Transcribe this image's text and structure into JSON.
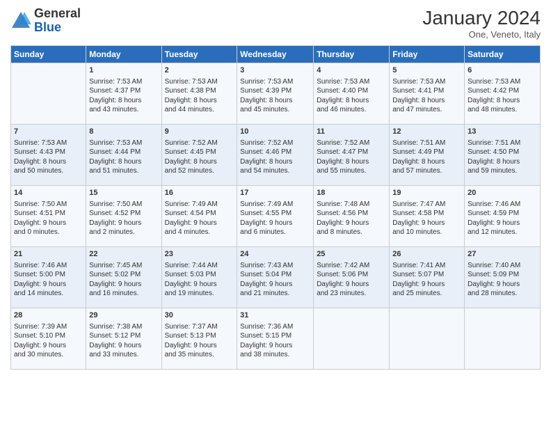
{
  "logo": {
    "general": "General",
    "blue": "Blue"
  },
  "title": "January 2024",
  "subtitle": "One, Veneto, Italy",
  "headers": [
    "Sunday",
    "Monday",
    "Tuesday",
    "Wednesday",
    "Thursday",
    "Friday",
    "Saturday"
  ],
  "weeks": [
    [
      {
        "day": "",
        "info": ""
      },
      {
        "day": "1",
        "info": "Sunrise: 7:53 AM\nSunset: 4:37 PM\nDaylight: 8 hours\nand 43 minutes."
      },
      {
        "day": "2",
        "info": "Sunrise: 7:53 AM\nSunset: 4:38 PM\nDaylight: 8 hours\nand 44 minutes."
      },
      {
        "day": "3",
        "info": "Sunrise: 7:53 AM\nSunset: 4:39 PM\nDaylight: 8 hours\nand 45 minutes."
      },
      {
        "day": "4",
        "info": "Sunrise: 7:53 AM\nSunset: 4:40 PM\nDaylight: 8 hours\nand 46 minutes."
      },
      {
        "day": "5",
        "info": "Sunrise: 7:53 AM\nSunset: 4:41 PM\nDaylight: 8 hours\nand 47 minutes."
      },
      {
        "day": "6",
        "info": "Sunrise: 7:53 AM\nSunset: 4:42 PM\nDaylight: 8 hours\nand 48 minutes."
      }
    ],
    [
      {
        "day": "7",
        "info": "Sunrise: 7:53 AM\nSunset: 4:43 PM\nDaylight: 8 hours\nand 50 minutes."
      },
      {
        "day": "8",
        "info": "Sunrise: 7:53 AM\nSunset: 4:44 PM\nDaylight: 8 hours\nand 51 minutes."
      },
      {
        "day": "9",
        "info": "Sunrise: 7:52 AM\nSunset: 4:45 PM\nDaylight: 8 hours\nand 52 minutes."
      },
      {
        "day": "10",
        "info": "Sunrise: 7:52 AM\nSunset: 4:46 PM\nDaylight: 8 hours\nand 54 minutes."
      },
      {
        "day": "11",
        "info": "Sunrise: 7:52 AM\nSunset: 4:47 PM\nDaylight: 8 hours\nand 55 minutes."
      },
      {
        "day": "12",
        "info": "Sunrise: 7:51 AM\nSunset: 4:49 PM\nDaylight: 8 hours\nand 57 minutes."
      },
      {
        "day": "13",
        "info": "Sunrise: 7:51 AM\nSunset: 4:50 PM\nDaylight: 8 hours\nand 59 minutes."
      }
    ],
    [
      {
        "day": "14",
        "info": "Sunrise: 7:50 AM\nSunset: 4:51 PM\nDaylight: 9 hours\nand 0 minutes."
      },
      {
        "day": "15",
        "info": "Sunrise: 7:50 AM\nSunset: 4:52 PM\nDaylight: 9 hours\nand 2 minutes."
      },
      {
        "day": "16",
        "info": "Sunrise: 7:49 AM\nSunset: 4:54 PM\nDaylight: 9 hours\nand 4 minutes."
      },
      {
        "day": "17",
        "info": "Sunrise: 7:49 AM\nSunset: 4:55 PM\nDaylight: 9 hours\nand 6 minutes."
      },
      {
        "day": "18",
        "info": "Sunrise: 7:48 AM\nSunset: 4:56 PM\nDaylight: 9 hours\nand 8 minutes."
      },
      {
        "day": "19",
        "info": "Sunrise: 7:47 AM\nSunset: 4:58 PM\nDaylight: 9 hours\nand 10 minutes."
      },
      {
        "day": "20",
        "info": "Sunrise: 7:46 AM\nSunset: 4:59 PM\nDaylight: 9 hours\nand 12 minutes."
      }
    ],
    [
      {
        "day": "21",
        "info": "Sunrise: 7:46 AM\nSunset: 5:00 PM\nDaylight: 9 hours\nand 14 minutes."
      },
      {
        "day": "22",
        "info": "Sunrise: 7:45 AM\nSunset: 5:02 PM\nDaylight: 9 hours\nand 16 minutes."
      },
      {
        "day": "23",
        "info": "Sunrise: 7:44 AM\nSunset: 5:03 PM\nDaylight: 9 hours\nand 19 minutes."
      },
      {
        "day": "24",
        "info": "Sunrise: 7:43 AM\nSunset: 5:04 PM\nDaylight: 9 hours\nand 21 minutes."
      },
      {
        "day": "25",
        "info": "Sunrise: 7:42 AM\nSunset: 5:06 PM\nDaylight: 9 hours\nand 23 minutes."
      },
      {
        "day": "26",
        "info": "Sunrise: 7:41 AM\nSunset: 5:07 PM\nDaylight: 9 hours\nand 25 minutes."
      },
      {
        "day": "27",
        "info": "Sunrise: 7:40 AM\nSunset: 5:09 PM\nDaylight: 9 hours\nand 28 minutes."
      }
    ],
    [
      {
        "day": "28",
        "info": "Sunrise: 7:39 AM\nSunset: 5:10 PM\nDaylight: 9 hours\nand 30 minutes."
      },
      {
        "day": "29",
        "info": "Sunrise: 7:38 AM\nSunset: 5:12 PM\nDaylight: 9 hours\nand 33 minutes."
      },
      {
        "day": "30",
        "info": "Sunrise: 7:37 AM\nSunset: 5:13 PM\nDaylight: 9 hours\nand 35 minutes."
      },
      {
        "day": "31",
        "info": "Sunrise: 7:36 AM\nSunset: 5:15 PM\nDaylight: 9 hours\nand 38 minutes."
      },
      {
        "day": "",
        "info": ""
      },
      {
        "day": "",
        "info": ""
      },
      {
        "day": "",
        "info": ""
      }
    ]
  ]
}
